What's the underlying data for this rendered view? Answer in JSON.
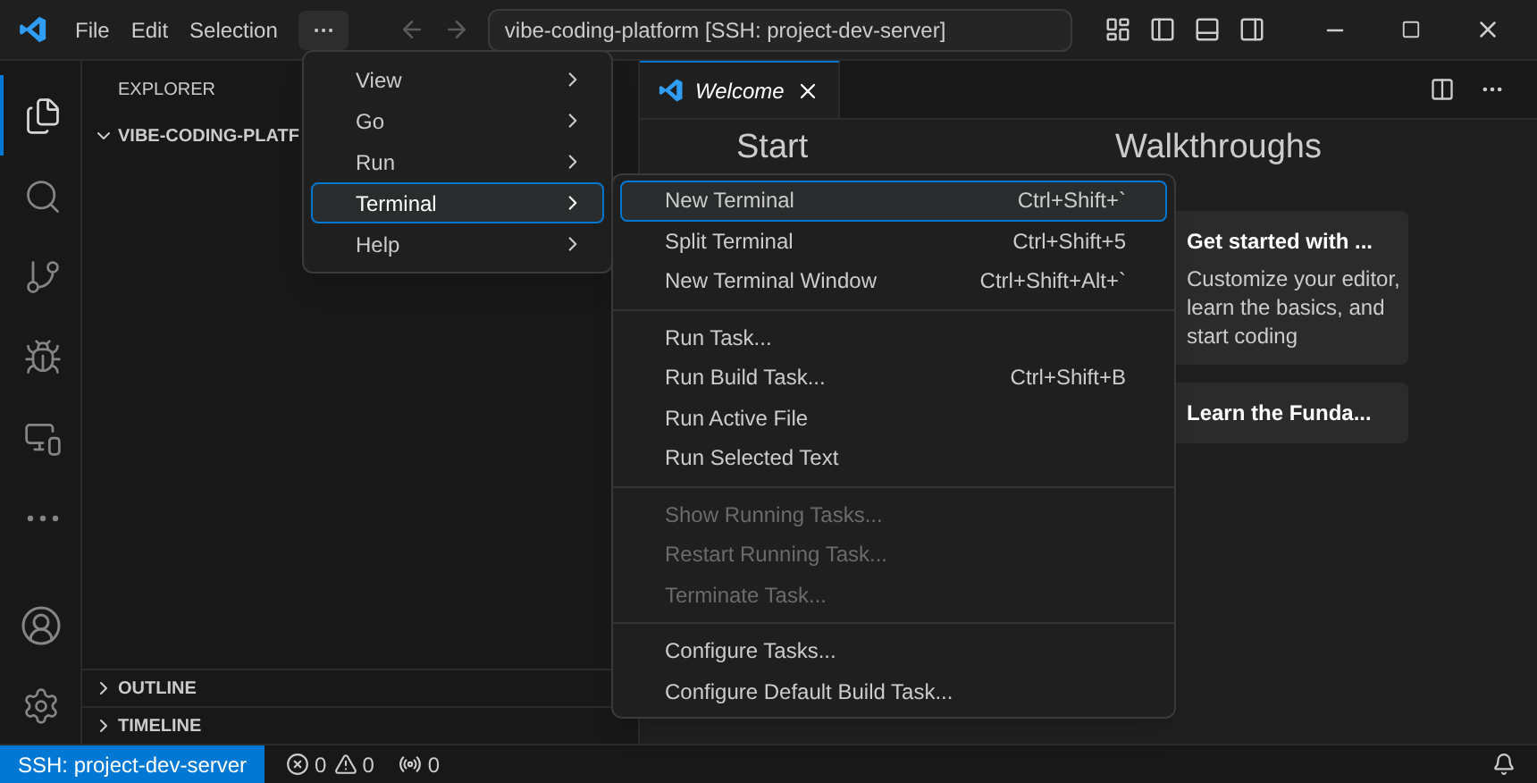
{
  "title_bar": {
    "menus": [
      "File",
      "Edit",
      "Selection"
    ],
    "more": "···",
    "command_center": "vibe-coding-platform [SSH: project-dev-server]"
  },
  "activity_bar": [
    {
      "kind": "files",
      "selected": true
    },
    {
      "kind": "search",
      "selected": false
    },
    {
      "kind": "source-control",
      "selected": false
    },
    {
      "kind": "run-debug",
      "selected": false
    },
    {
      "kind": "remote",
      "selected": false
    },
    {
      "kind": "more",
      "selected": false
    }
  ],
  "sidebar": {
    "title": "EXPLORER",
    "folder": {
      "label": "VIBE-CODING-PLATF",
      "expanded": true
    },
    "sections": [
      {
        "label": "OUTLINE",
        "expanded": false
      },
      {
        "label": "TIMELINE",
        "expanded": false
      }
    ]
  },
  "editor": {
    "tabs": [
      {
        "label": "Welcome",
        "selected": true
      }
    ],
    "start_heading": "Start",
    "walkthroughs_heading": "Walkthroughs",
    "walkthroughs": [
      {
        "title": "Get started with ...",
        "description": "Customize your editor, learn the basics, and start coding"
      },
      {
        "title": "Learn the Funda..."
      }
    ]
  },
  "menu": {
    "items": [
      {
        "label": "View",
        "selected": false
      },
      {
        "label": "Go",
        "selected": false
      },
      {
        "label": "Run",
        "selected": false
      },
      {
        "label": "Terminal",
        "selected": true
      },
      {
        "label": "Help",
        "selected": false
      }
    ]
  },
  "submenu": {
    "groups": [
      [
        {
          "label": "New Terminal",
          "shortcut": "Ctrl+Shift+`",
          "selected": true,
          "disabled": false
        },
        {
          "label": "Split Terminal",
          "shortcut": "Ctrl+Shift+5",
          "selected": false,
          "disabled": false
        },
        {
          "label": "New Terminal Window",
          "shortcut": "Ctrl+Shift+Alt+`",
          "selected": false,
          "disabled": false
        }
      ],
      [
        {
          "label": "Run Task...",
          "selected": false,
          "disabled": false
        },
        {
          "label": "Run Build Task...",
          "shortcut": "Ctrl+Shift+B",
          "selected": false,
          "disabled": false
        },
        {
          "label": "Run Active File",
          "selected": false,
          "disabled": false
        },
        {
          "label": "Run Selected Text",
          "selected": false,
          "disabled": false
        }
      ],
      [
        {
          "label": "Show Running Tasks...",
          "selected": false,
          "disabled": true
        },
        {
          "label": "Restart Running Task...",
          "selected": false,
          "disabled": true
        },
        {
          "label": "Terminate Task...",
          "selected": false,
          "disabled": true
        }
      ],
      [
        {
          "label": "Configure Tasks...",
          "selected": false,
          "disabled": false
        },
        {
          "label": "Configure Default Build Task...",
          "selected": false,
          "disabled": false
        }
      ]
    ]
  },
  "status_bar": {
    "remote": "SSH: project-dev-server",
    "errors": "0",
    "warnings": "0",
    "ports": "0"
  }
}
